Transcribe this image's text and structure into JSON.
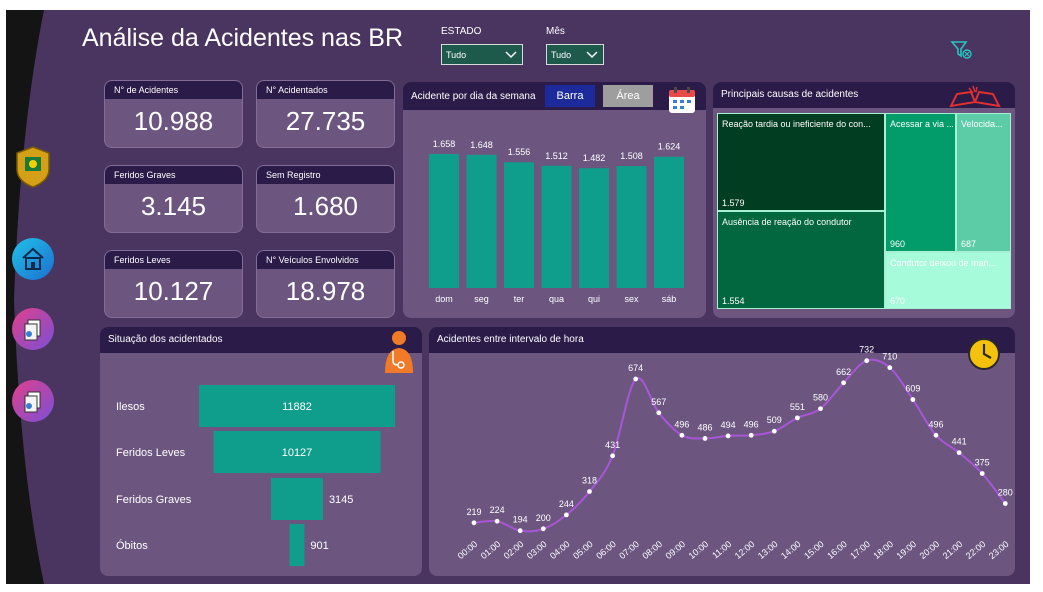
{
  "header": {
    "title": "Análise da Acidentes nas BR"
  },
  "filters": {
    "estado": {
      "label": "ESTADO",
      "value": "Tudo"
    },
    "mes": {
      "label": "Mês",
      "value": "Tudo"
    }
  },
  "nav": {
    "icons": [
      "police-badge-icon",
      "home-icon",
      "report-icon",
      "report-icon"
    ]
  },
  "kpis": [
    {
      "label": "N° de Acidentes",
      "value": "10.988"
    },
    {
      "label": "N° Acidentados",
      "value": "27.735"
    },
    {
      "label": "Feridos Graves",
      "value": "3.145"
    },
    {
      "label": "Sem Registro",
      "value": "1.680"
    },
    {
      "label": "Feridos Leves",
      "value": "10.127"
    },
    {
      "label": "N° Veículos Envolvidos",
      "value": "18.978"
    }
  ],
  "weekday_panel": {
    "title": "Acidente por dia da semana",
    "toggle": {
      "bar_label": "Barra",
      "area_label": "Área"
    }
  },
  "causes_panel": {
    "title": "Principais causas de acidentes"
  },
  "status_panel": {
    "title": "Situação dos acidentados"
  },
  "hour_panel": {
    "title": "Acidentes entre intervalo de hora"
  },
  "colors": {
    "teal": "#0f9e8b",
    "purple_line": "#a855d8",
    "header_bg": "#2a1b48",
    "panel_bg": "#6c5680"
  },
  "chart_data": [
    {
      "type": "bar",
      "categories": [
        "dom",
        "seg",
        "ter",
        "qua",
        "qui",
        "sex",
        "sáb"
      ],
      "values": [
        1658,
        1648,
        1556,
        1512,
        1482,
        1508,
        1624
      ],
      "labels": [
        "1.658",
        "1.648",
        "1.556",
        "1.512",
        "1.482",
        "1.508",
        "1.624"
      ]
    },
    {
      "type": "treemap",
      "items": [
        {
          "name": "Reação tardia ou ineficiente do con...",
          "value": 1579,
          "label": "1.579"
        },
        {
          "name": "Ausência de reação do condutor",
          "value": 1554,
          "label": "1.554"
        },
        {
          "name": "Acessar a via ...",
          "value": 960,
          "label": "960"
        },
        {
          "name": "Velocida...",
          "value": 687,
          "label": "687"
        },
        {
          "name": "Condutor deixou de man...",
          "value": 670,
          "label": "670"
        }
      ]
    },
    {
      "type": "funnel",
      "categories": [
        "Ilesos",
        "Feridos Leves",
        "Feridos Graves",
        "Óbitos"
      ],
      "values": [
        11882,
        10127,
        3145,
        901
      ]
    },
    {
      "type": "line",
      "categories": [
        "00:00",
        "01:00",
        "02:00",
        "03:00",
        "04:00",
        "05:00",
        "06:00",
        "07:00",
        "08:00",
        "09:00",
        "10:00",
        "11:00",
        "12:00",
        "13:00",
        "14:00",
        "15:00",
        "16:00",
        "17:00",
        "18:00",
        "19:00",
        "20:00",
        "21:00",
        "22:00",
        "23:00"
      ],
      "values": [
        219,
        224,
        194,
        200,
        244,
        318,
        431,
        674,
        567,
        496,
        486,
        494,
        496,
        509,
        551,
        580,
        662,
        732,
        710,
        609,
        496,
        441,
        375,
        280
      ]
    }
  ]
}
